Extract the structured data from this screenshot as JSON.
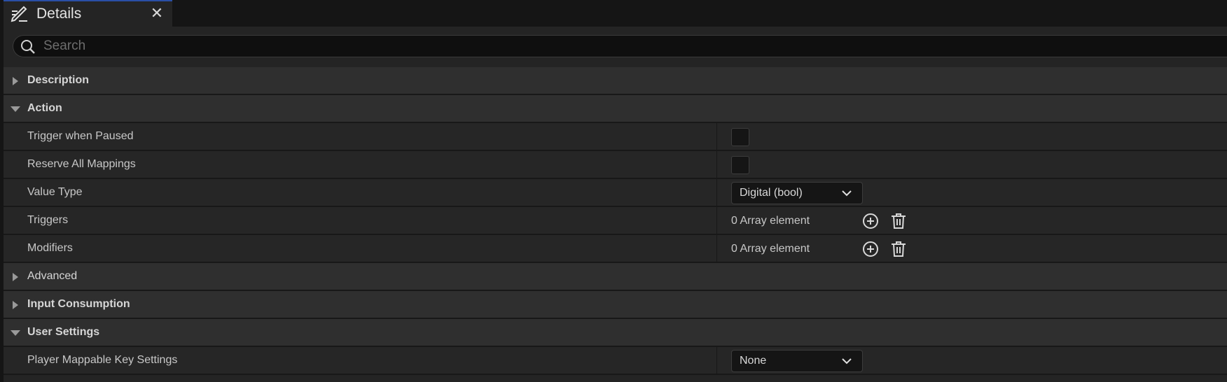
{
  "tab": {
    "title": "Details",
    "close_glyph": "✕",
    "icon": "pencil-details-icon"
  },
  "search": {
    "placeholder": "Search",
    "value": ""
  },
  "categories": {
    "description": {
      "label": "Description",
      "expanded": false
    },
    "action": {
      "label": "Action",
      "expanded": true
    },
    "advanced": {
      "label": "Advanced",
      "expanded": false
    },
    "input_consumption": {
      "label": "Input Consumption",
      "expanded": false
    },
    "user_settings": {
      "label": "User Settings",
      "expanded": true
    }
  },
  "properties": {
    "trigger_when_paused": {
      "label": "Trigger when Paused",
      "checked": false
    },
    "reserve_all_mappings": {
      "label": "Reserve All Mappings",
      "checked": false
    },
    "value_type": {
      "label": "Value Type",
      "value": "Digital (bool)"
    },
    "triggers": {
      "label": "Triggers",
      "value": "0 Array element"
    },
    "modifiers": {
      "label": "Modifiers",
      "value": "0 Array element"
    },
    "player_mappable_key_settings": {
      "label": "Player Mappable Key Settings",
      "value": "None"
    }
  },
  "colors": {
    "tab_accent": "#2a4fa6",
    "panel_bg": "#242424",
    "category_bg": "#2f2f2f"
  }
}
